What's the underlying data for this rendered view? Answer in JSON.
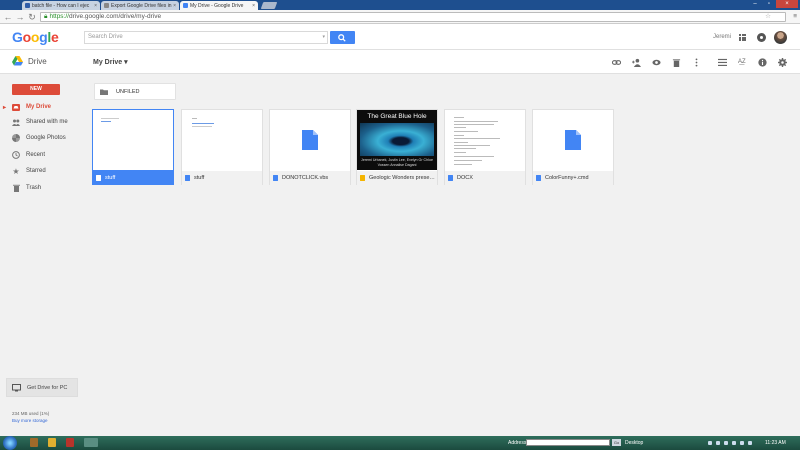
{
  "browser": {
    "tabs": [
      {
        "title": "batch file - How can I ejec",
        "favicon": "#2f5da8",
        "active": false
      },
      {
        "title": "Export Google Drive files in",
        "favicon": "#888888",
        "active": false
      },
      {
        "title": "My Drive - Google Drive",
        "favicon": "#4285f4",
        "active": true
      }
    ],
    "url_scheme": "https://",
    "url_rest": "drive.google.com/drive/my-drive"
  },
  "header": {
    "logo_letters": [
      "G",
      "o",
      "o",
      "g",
      "l",
      "e"
    ],
    "search_placeholder": "Search Drive",
    "user_name": "Jeremi"
  },
  "subheader": {
    "product": "Drive",
    "location": "My Drive",
    "tools": [
      "link-icon",
      "add-person-icon",
      "preview-icon",
      "trash-icon",
      "more-vert-icon",
      "list-view-icon",
      "sort-az-icon",
      "info-icon",
      "settings-icon"
    ]
  },
  "sidebar": {
    "new_label": "NEW",
    "items": [
      {
        "label": "My Drive",
        "icon": "my-drive-icon",
        "active": true
      },
      {
        "label": "Shared with me",
        "icon": "shared-icon",
        "active": false
      },
      {
        "label": "Google Photos",
        "icon": "photos-icon",
        "active": false
      },
      {
        "label": "Recent",
        "icon": "clock-icon",
        "active": false
      },
      {
        "label": "Starred",
        "icon": "star-icon",
        "active": false
      },
      {
        "label": "Trash",
        "icon": "trash-icon",
        "active": false
      }
    ],
    "get_drive": "Get Drive for PC",
    "storage_used": "234 MB used (1%)",
    "buy_storage": "Buy more storage"
  },
  "content": {
    "folders": [
      {
        "name": "UNFILED"
      }
    ],
    "files": [
      {
        "name": "stuff",
        "type": "doc",
        "icon_color": "#4285f4",
        "thumb": "doc-short",
        "selected": true
      },
      {
        "name": "stuff",
        "type": "doc",
        "icon_color": "#4285f4",
        "thumb": "doc-short",
        "selected": false
      },
      {
        "name": "DONOTCLICK.vbs",
        "type": "file",
        "icon_color": "#4285f4",
        "thumb": "generic",
        "selected": false
      },
      {
        "name": "Geologic Wonders prese…",
        "type": "slides",
        "icon_color": "#f4b400",
        "thumb": "slide",
        "selected": false
      },
      {
        "name": "DOCX",
        "type": "doc",
        "icon_color": "#4285f4",
        "thumb": "doc-long",
        "selected": false
      },
      {
        "name": "ColorFunny+.cmd",
        "type": "file",
        "icon_color": "#4285f4",
        "thumb": "generic",
        "selected": false
      }
    ],
    "slide": {
      "title": "The Great Blue Hole",
      "authors": "Jeremi Urbanek, Justin Lee, Evelyn Gr Chloe Vossen Annalise Dagani"
    }
  },
  "taskbar": {
    "address_label": "Address",
    "go_label": "Go",
    "desktop_label": "Desktop",
    "time": "11:23 AM"
  }
}
